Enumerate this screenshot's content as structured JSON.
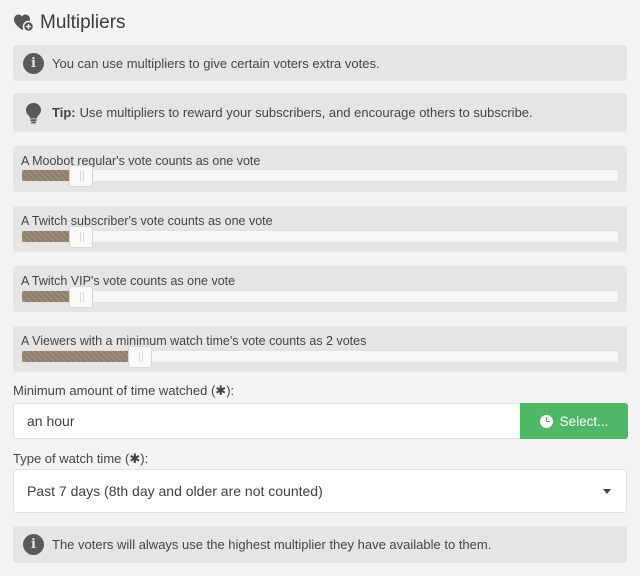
{
  "header": {
    "title": "Multipliers",
    "icon": "heart-plus-icon"
  },
  "info_notice": {
    "icon": "info-icon",
    "text": "You can use multipliers to give certain voters extra votes."
  },
  "tip_notice": {
    "icon": "lightbulb-icon",
    "strong": "Tip:",
    "text": "Use multipliers to reward your subscribers, and encourage others to subscribe."
  },
  "sliders": [
    {
      "label": "A Moobot regular's vote counts as one vote",
      "fill_fraction": 0.08
    },
    {
      "label": "A Twitch subscriber's vote counts as one vote",
      "fill_fraction": 0.08
    },
    {
      "label": "A Twitch VIP's vote counts as one vote",
      "fill_fraction": 0.08
    },
    {
      "label": "A Viewers with a minimum watch time's vote counts as 2 votes",
      "fill_fraction": 0.18
    }
  ],
  "min_watch": {
    "label": "Minimum amount of time watched (",
    "req": "✱",
    "label_end": "):",
    "value": "an hour",
    "button": "Select...",
    "button_icon": "clock-icon"
  },
  "watch_type": {
    "label": "Type of watch time (",
    "req": "✱",
    "label_end": "):",
    "selected": "Past 7 days (8th day and older are not counted)"
  },
  "bottom_notice": {
    "icon": "info-icon",
    "text": "The voters will always use the highest multiplier they have available to them."
  },
  "colors": {
    "accent_green": "#4fb867",
    "slider_fill": "#8d7f6c",
    "box_bg": "#e5e5e5"
  }
}
